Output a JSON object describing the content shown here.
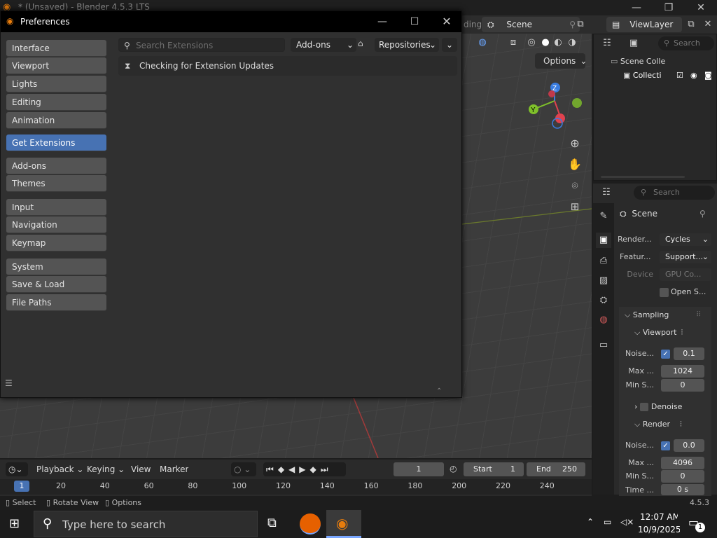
{
  "window": {
    "title": "* (Unsaved) - Blender 4.5.3 LTS"
  },
  "header": {
    "scene_label": "Scene",
    "viewlayer_label": "ViewLayer",
    "options_label": "Options",
    "partial_word": "ding"
  },
  "outliner": {
    "search_placeholder": "Search",
    "root_label": "Scene Colle",
    "collection_label": "Collecti"
  },
  "properties": {
    "search_placeholder": "Search",
    "context_title": "Scene",
    "rows": [
      {
        "label": "Render...",
        "value": "Cycles"
      },
      {
        "label": "Featur...",
        "value": "Support..."
      },
      {
        "label": "Device",
        "value": "GPU Co..."
      }
    ],
    "open_label": "Open S...",
    "sampling": {
      "title": "Sampling",
      "viewport": {
        "title": "Viewport",
        "noise_label": "Noise...",
        "noise_value": "0.1",
        "max_label": "Max ...",
        "max_value": "1024",
        "min_label": "Min S...",
        "min_value": "0"
      },
      "denoise_label": "Denoise",
      "render": {
        "title": "Render",
        "noise_label": "Noise...",
        "noise_value": "0.0",
        "max_label": "Max ...",
        "max_value": "4096",
        "min_label": "Min S...",
        "min_value": "0",
        "time_label": "Time ...",
        "time_value": "0 s"
      }
    }
  },
  "timeline": {
    "menus": [
      "Playback",
      "Keying",
      "View",
      "Marker"
    ],
    "current_frame": "1",
    "start_label": "Start",
    "start_value": "1",
    "end_label": "End",
    "end_value": "250",
    "ruler": [
      "20",
      "40",
      "60",
      "80",
      "100",
      "120",
      "140",
      "160",
      "180",
      "200",
      "220",
      "240"
    ],
    "frame_badge": "1"
  },
  "status": {
    "select": "Select",
    "rotate": "Rotate View",
    "options": "Options",
    "version": "4.5.3"
  },
  "taskbar": {
    "search_placeholder": "Type here to search",
    "time": "12:07 AM",
    "date": "10/9/2025",
    "notif_count": "1"
  },
  "preferences": {
    "title": "Preferences",
    "search_placeholder": "Search Extensions",
    "filter_dropdown": "Add-ons",
    "repos_dropdown": "Repositories",
    "status_message": "Checking for Extension Updates",
    "nav_groups": [
      [
        "Interface",
        "Viewport",
        "Lights",
        "Editing",
        "Animation"
      ],
      [
        "Get Extensions"
      ],
      [
        "Add-ons",
        "Themes"
      ],
      [
        "Input",
        "Navigation",
        "Keymap"
      ],
      [
        "System",
        "Save & Load",
        "File Paths"
      ]
    ],
    "active_item": "Get Extensions"
  },
  "colors": {
    "accent": "#4772b3",
    "axis_x": "#e0424e",
    "axis_y": "#7fc02a",
    "axis_z": "#3a7de0"
  }
}
